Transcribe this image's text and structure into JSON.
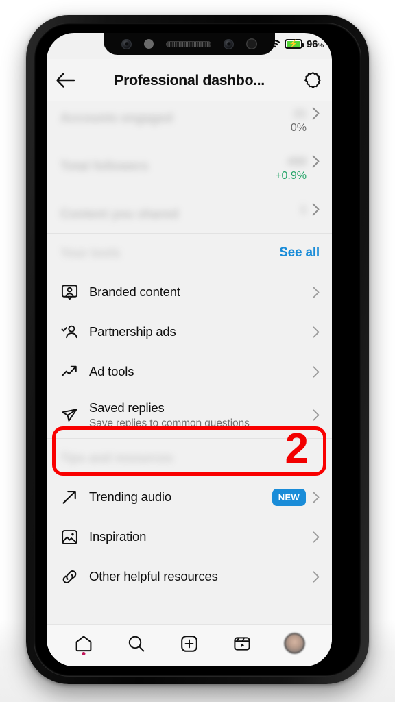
{
  "status_bar": {
    "wifi_icon": "wifi-icon",
    "battery_icon": "battery-charging-icon",
    "battery_percent": "96",
    "percent_symbol": "%"
  },
  "header": {
    "back_icon": "back-arrow-icon",
    "title": "Professional dashbo...",
    "settings_icon": "gear-icon"
  },
  "overview": {
    "rows": [
      {
        "label": "Accounts engaged",
        "value": "21",
        "delta": "0%",
        "delta_positive": false,
        "chevron": "chevron-right-icon"
      },
      {
        "label": "Total followers",
        "value": "458",
        "delta": "+0.9%",
        "delta_positive": true,
        "chevron": "chevron-right-icon"
      },
      {
        "label": "Content you shared",
        "value": "1",
        "delta": "",
        "delta_positive": false,
        "chevron": "chevron-right-icon"
      }
    ]
  },
  "your_tools": {
    "section_title": "Your tools",
    "see_all_label": "See all",
    "see_all_color": "#1a8cd8",
    "items": [
      {
        "icon": "branded-content-icon",
        "label": "Branded content",
        "sublabel": "",
        "badge": "",
        "chevron": "chevron-right-icon"
      },
      {
        "icon": "partnership-ads-icon",
        "label": "Partnership ads",
        "sublabel": "",
        "badge": "",
        "chevron": "chevron-right-icon"
      },
      {
        "icon": "ad-tools-icon",
        "label": "Ad tools",
        "sublabel": "",
        "badge": "",
        "chevron": "chevron-right-icon"
      },
      {
        "icon": "saved-replies-icon",
        "label": "Saved replies",
        "sublabel": "Save replies to common questions",
        "badge": "",
        "chevron": "chevron-right-icon"
      }
    ]
  },
  "tips_and_resources": {
    "section_title": "Tips and resources",
    "items": [
      {
        "icon": "trending-audio-icon",
        "label": "Trending audio",
        "sublabel": "",
        "badge": "NEW",
        "chevron": "chevron-right-icon"
      },
      {
        "icon": "inspiration-icon",
        "label": "Inspiration",
        "sublabel": "",
        "badge": "",
        "chevron": "chevron-right-icon"
      },
      {
        "icon": "other-helpful-resources-icon",
        "label": "Other helpful resources",
        "sublabel": "",
        "badge": "",
        "chevron": "chevron-right-icon"
      }
    ]
  },
  "annotation": {
    "step_number": "2",
    "highlight_color": "#f90000",
    "highlight_target": "Saved replies"
  },
  "bottom_nav": {
    "items": [
      {
        "icon": "home-icon",
        "name": "nav-home"
      },
      {
        "icon": "search-icon",
        "name": "nav-search"
      },
      {
        "icon": "create-plus-icon",
        "name": "nav-create"
      },
      {
        "icon": "reels-icon",
        "name": "nav-reels"
      },
      {
        "icon": "profile-avatar",
        "name": "nav-profile"
      }
    ]
  },
  "badge_colors": {
    "new_badge_bg": "#1a8cd8",
    "notification_dot": "#c2185b",
    "positive_delta": "#21a366"
  }
}
